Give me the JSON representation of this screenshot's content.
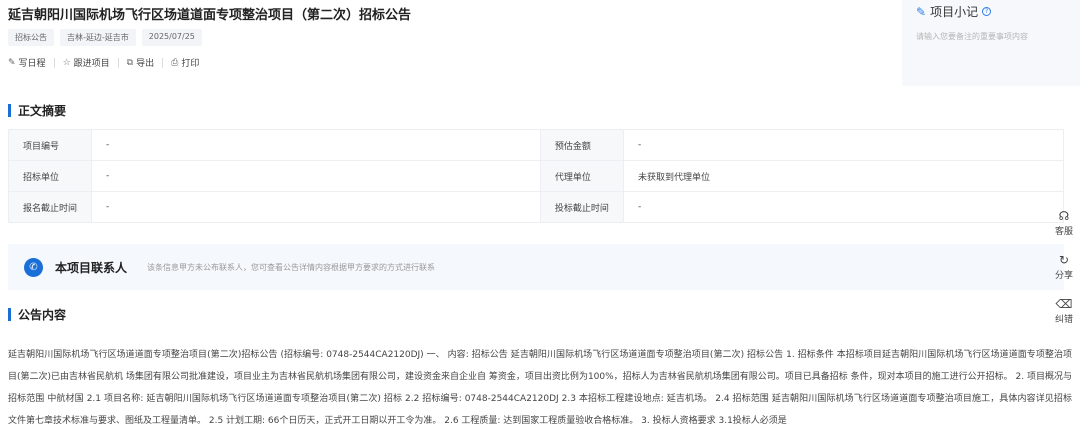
{
  "header": {
    "title": "延吉朝阳川国际机场飞行区场道道面专项整治项目（第二次）招标公告",
    "tags": [
      "招标公告",
      "吉林-延边-延吉市",
      "2025/07/25"
    ]
  },
  "actions": [
    {
      "icon": "calendar-icon",
      "label": "写日程"
    },
    {
      "icon": "star-icon",
      "label": "跟进项目"
    },
    {
      "icon": "export-icon",
      "label": "导出"
    },
    {
      "icon": "print-icon",
      "label": "打印"
    }
  ],
  "memo": {
    "title": "项目小记",
    "placeholder": "请输入您要备注的重要事项内容"
  },
  "summary": {
    "title": "正文摘要",
    "rows": [
      {
        "l1": "项目编号",
        "v1": "-",
        "l2": "预估金额",
        "v2": "-"
      },
      {
        "l1": "招标单位",
        "v1": "-",
        "l2": "代理单位",
        "v2": "未获取到代理单位"
      },
      {
        "l1": "报名截止时间",
        "v1": "-",
        "l2": "投标截止时间",
        "v2": "-"
      }
    ]
  },
  "contact": {
    "title": "本项目联系人",
    "desc": "该条信息甲方未公布联系人，您可查看公告详情内容根据甲方要求的方式进行联系"
  },
  "content": {
    "title": "公告内容",
    "text": "延吉朝阳川国际机场飞行区场道道面专项整治项目(第二次)招标公告 (招标编号: 0748-2544CA2120DJ) 一、 内容: 招标公告 延吉朝阳川国际机场飞行区场道道面专项整治项目(第二次) 招标公告 1. 招标条件 本招标项目延吉朝阳川国际机场飞行区场道道面专项整治项目(第二次)已由吉林省民航机 场集团有限公司批准建设，项目业主为吉林省民航机场集团有限公司，建设资金来自企业自 筹资金，项目出资比例为100%，招标人为吉林省民航机场集团有限公司。项目已具备招标 条件，现对本项目的施工进行公开招标。 2. 项目概况与招标范围 中航材国 2.1 项目名称: 延吉朝阳川国际机场飞行区场道道面专项整治项目(第二次) 招标 2.2 招标编号: 0748-2544CA2120DJ 2.3 本招标工程建设地点: 延吉机场。 2.4 招标范围 延吉朝阳川国际机场飞行区场道道面专项整治项目施工，具体内容详见招标 文件第七章技术标准与要求、图纸及工程量清单。 2.5 计划工期: 66个日历天，正式开工日期以开工令为准。 2.6 工程质量: 达到国家工程质量验收合格标准。 3. 投标人资格要求 3.1投标人必须是"
  },
  "side": [
    {
      "icon": "headset-icon",
      "label": "客服"
    },
    {
      "icon": "share-icon",
      "label": "分享"
    },
    {
      "icon": "eraser-icon",
      "label": "纠错"
    }
  ]
}
